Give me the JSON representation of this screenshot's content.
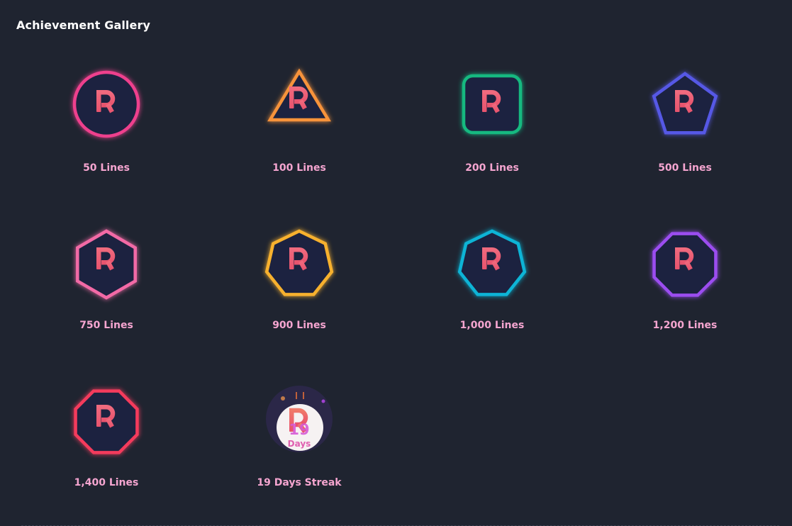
{
  "gallery": {
    "title": "Achievement Gallery"
  },
  "badges": [
    {
      "label": "50 Lines",
      "shape": "circle",
      "color": "#ee3f8d",
      "icon": "r-logo-icon"
    },
    {
      "label": "100 Lines",
      "shape": "triangle",
      "color": "#f7933a",
      "icon": "r-logo-icon"
    },
    {
      "label": "200 Lines",
      "shape": "square",
      "color": "#12b980",
      "icon": "r-logo-icon"
    },
    {
      "label": "500 Lines",
      "shape": "pentagon",
      "color": "#5659e6",
      "icon": "r-logo-icon"
    },
    {
      "label": "750 Lines",
      "shape": "hexagon",
      "color": "#f26ba6",
      "icon": "r-logo-icon"
    },
    {
      "label": "900 Lines",
      "shape": "heptagon",
      "color": "#f7b12d",
      "icon": "r-logo-icon"
    },
    {
      "label": "1,000 Lines",
      "shape": "heptagon",
      "color": "#0eb4d6",
      "icon": "r-logo-icon"
    },
    {
      "label": "1,200 Lines",
      "shape": "octagon",
      "color": "#9b4df0",
      "icon": "r-logo-icon"
    },
    {
      "label": "1,400 Lines",
      "shape": "octagon",
      "color": "#f43b5c",
      "icon": "r-logo-icon"
    }
  ],
  "streak": {
    "label": "19 Days Streak",
    "days": "19",
    "unit": "Days",
    "icon": "r-logo-icon"
  },
  "colors": {
    "background": "#1f2430",
    "badge_fill": "#1d2440",
    "label": "#f5a5d0",
    "r_top": "#f06a7e",
    "r_bottom": "#e8546e"
  }
}
